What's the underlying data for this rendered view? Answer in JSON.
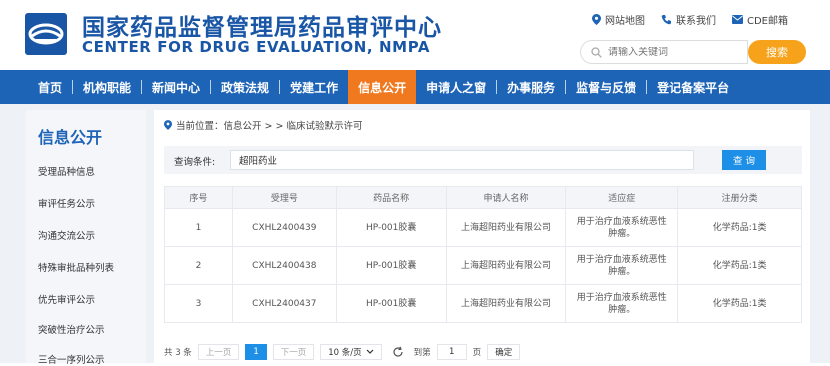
{
  "header": {
    "title_cn": "国家药品监督管理局药品审评中心",
    "title_en": "CENTER FOR DRUG EVALUATION, NMPA",
    "links": [
      "网站地图",
      "联系我们",
      "CDE邮箱"
    ],
    "search_placeholder": "请输入关键词",
    "search_button": "搜索"
  },
  "nav": {
    "items": [
      "首页",
      "机构职能",
      "新闻中心",
      "政策法规",
      "党建工作",
      "信息公开",
      "申请人之窗",
      "办事服务",
      "监督与反馈",
      "登记备案平台"
    ],
    "active": "信息公开"
  },
  "sidebar": {
    "title": "信息公开",
    "items": [
      "受理品种信息",
      "审评任务公示",
      "沟通交流公示",
      "特殊审批品种列表",
      "优先审评公示",
      "突破性治疗公示",
      "三合一序列公示"
    ]
  },
  "content": {
    "breadcrumb": "当前位置：信息公开 > > 临床试验默示许可",
    "query_label": "查询条件:",
    "query_value": "超阳药业",
    "query_button": "查 询",
    "headers": [
      "序号",
      "受理号",
      "药品名称",
      "申请人名称",
      "适应症",
      "注册分类"
    ],
    "rows": [
      [
        "1",
        "CXHL2400439",
        "HP-001胶囊",
        "上海超阳药业有限公司",
        "用于治疗血液系统恶性肿瘤。",
        "化学药品:1类"
      ],
      [
        "2",
        "CXHL2400438",
        "HP-001胶囊",
        "上海超阳药业有限公司",
        "用于治疗血液系统恶性肿瘤。",
        "化学药品:1类"
      ],
      [
        "3",
        "CXHL2400437",
        "HP-001胶囊",
        "上海超阳药业有限公司",
        "用于治疗血液系统恶性肿瘤。",
        "化学药品:1类"
      ]
    ]
  },
  "pager": {
    "total": "共 3 条",
    "prev": "上一页",
    "current": "1",
    "next": "下一页",
    "page_size": "10 条/页",
    "goto_label": "到第",
    "goto_value": "1",
    "page_unit": "页",
    "confirm": "确定"
  },
  "colors": {
    "brand_blue": "#1d63b6",
    "accent_orange": "#f0781e",
    "button_blue": "#1d8fe6"
  }
}
